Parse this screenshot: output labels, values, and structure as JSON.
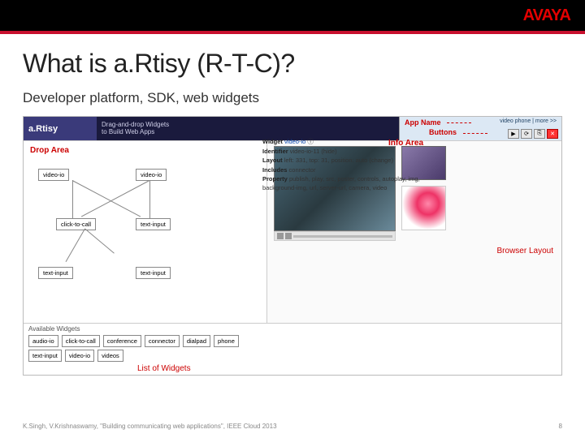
{
  "brand": "AVAYA",
  "title": "What is a.Rtisy (R-T-C)?",
  "subtitle": "Developer platform, SDK, web widgets",
  "mockup": {
    "brand": "a.Rtisy",
    "tagline1": "Drag-and-drop Widgets",
    "tagline2": "to Build Web Apps",
    "app_name_label": "App Name",
    "buttons_label": "Buttons",
    "more_link": "video phone | more >>",
    "drop_area": "Drop Area",
    "browser_layout": "Browser Layout",
    "list_of_widgets": "List of Widgets",
    "info_area": "Info Area",
    "nodes": {
      "video_io_1": "video-io",
      "video_io_2": "video-io",
      "click_to_call": "click-to-call",
      "text_input_1": "text-input",
      "text_input_2": "text-input",
      "text_input_3": "text-input"
    },
    "available_widgets": "Available Widgets",
    "widgets_row1": [
      "audio-io",
      "click-to-call",
      "conference",
      "connector",
      "dialpad",
      "phone"
    ],
    "widgets_row2": [
      "text-input",
      "video-io",
      "videos"
    ],
    "info": {
      "widget_label": "Widget",
      "widget_value": "video-io",
      "identifier_label": "Identifier",
      "identifier_value": "video-io-11 (hide)",
      "layout_label": "Layout",
      "layout_value": "left: 331, top: 31, position: auto (change)",
      "includes_label": "Includes",
      "includes_value": "connector",
      "property_label": "Property",
      "property_value": "publish, play, src, poster, controls, autoplay, img, background-img, url, server-url, camera, video"
    }
  },
  "footer": {
    "citation": "K.Singh, V.Krishnaswamy, \"Building communicating web applications\", IEEE Cloud 2013",
    "page": "8"
  }
}
